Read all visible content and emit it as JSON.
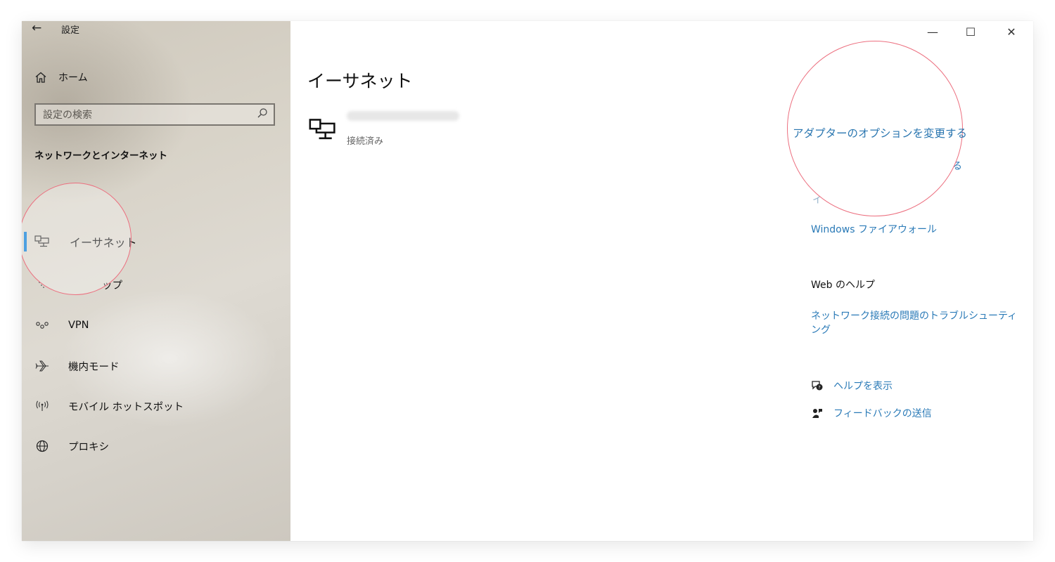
{
  "window": {
    "back_symbol": "←",
    "title": "設定",
    "controls": {
      "minimize": "—",
      "maximize": "☐",
      "close": "✕"
    }
  },
  "sidebar": {
    "home_label": "ホーム",
    "search_placeholder": "設定の検索",
    "section_title": "ネットワークとインターネット",
    "items": [
      {
        "label": "イーサネット",
        "icon": "ethernet-icon",
        "selected": true
      },
      {
        "label": "ップ",
        "icon": "dialup-icon",
        "selected": false
      },
      {
        "label": "VPN",
        "icon": "vpn-icon",
        "selected": false
      },
      {
        "label": "機内モード",
        "icon": "airplane-icon",
        "selected": false
      },
      {
        "label": "モバイル ホットスポット",
        "icon": "hotspot-icon",
        "selected": false
      },
      {
        "label": "プロキシ",
        "icon": "globe-icon",
        "selected": false
      }
    ]
  },
  "main": {
    "title": "イーサネット",
    "network_status": "接続済み"
  },
  "related": {
    "adapter_options": "アダプターのオプションを変更する",
    "partial_link_suffix": "る",
    "partial_link_fragment": "イ",
    "firewall": "Windows ファイアウォール",
    "web_help_heading": "Web のヘルプ",
    "troubleshoot": "ネットワーク接続の問題のトラブルシューティング",
    "get_help": "ヘルプを表示",
    "feedback": "フィードバックの送信"
  },
  "colors": {
    "accent": "#0078d4",
    "link": "#2a7ab7",
    "highlight_ring": "#ec6f7f"
  }
}
